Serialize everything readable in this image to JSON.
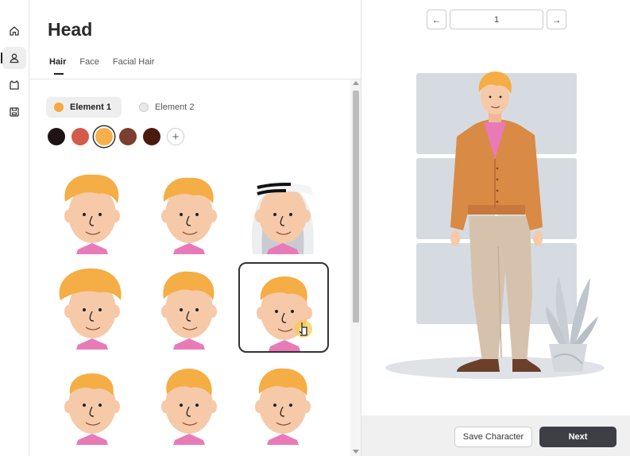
{
  "sidebar": {
    "items": [
      {
        "icon": "home-icon",
        "active": false
      },
      {
        "icon": "user-icon",
        "active": true
      },
      {
        "icon": "shirt-icon",
        "active": false
      },
      {
        "icon": "save-icon",
        "active": false
      }
    ]
  },
  "editor": {
    "title": "Head",
    "tabs": [
      {
        "label": "Hair",
        "active": true
      },
      {
        "label": "Face",
        "active": false
      },
      {
        "label": "Facial Hair",
        "active": false
      }
    ],
    "elements": [
      {
        "label": "Element 1",
        "color": "#f5a93f",
        "active": true
      },
      {
        "label": "Element 2",
        "color": "#e9e9e9",
        "active": false
      }
    ],
    "swatches": [
      {
        "color": "#1e1416",
        "selected": false
      },
      {
        "color": "#d45a4a",
        "selected": false
      },
      {
        "color": "#f5b04b",
        "selected": true
      },
      {
        "color": "#7a3f2f",
        "selected": false
      },
      {
        "color": "#4a1a0e",
        "selected": false
      }
    ],
    "add_swatch_symbol": "+",
    "selected_hair_index": 5
  },
  "preview": {
    "page_value": "1",
    "prev_symbol": "←",
    "next_symbol": "→"
  },
  "footer": {
    "save_label": "Save Character",
    "next_label": "Next"
  },
  "colors": {
    "hair": "#f5ad45",
    "skin": "#f6c9a8",
    "cardigan": "#d98a45",
    "shirt": "#e97ab8",
    "pants": "#d6c2ac",
    "shoes": "#6b3f2a",
    "backdrop": "#d6dbe1"
  }
}
